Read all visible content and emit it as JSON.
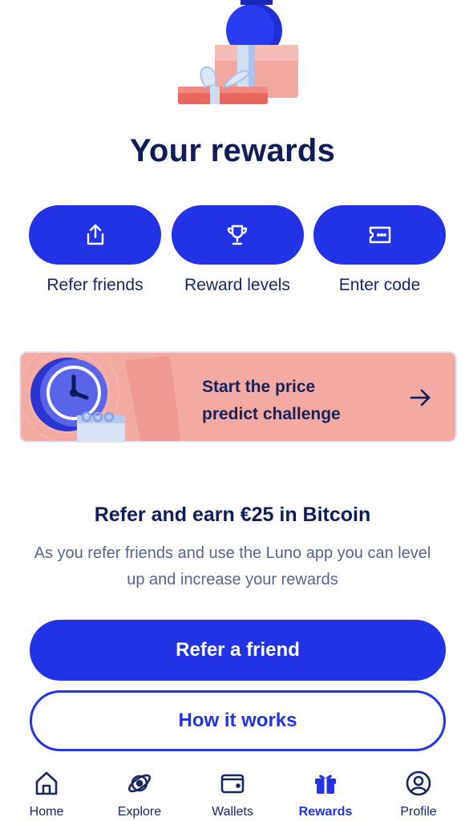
{
  "page": {
    "title": "Your rewards"
  },
  "actions": [
    {
      "label": "Refer friends",
      "icon": "share-icon"
    },
    {
      "label": "Reward levels",
      "icon": "trophy-icon"
    },
    {
      "label": "Enter code",
      "icon": "ticket-icon"
    }
  ],
  "promo": {
    "line1": "Start the price",
    "line2": "predict challenge",
    "icon": "arrow-right-icon"
  },
  "refer": {
    "title": "Refer and earn €25 in Bitcoin",
    "description": "As you refer friends and use the Luno app you can level up and increase your rewards"
  },
  "buttons": {
    "primary": "Refer a friend",
    "secondary": "How it works"
  },
  "tabs": [
    {
      "label": "Home",
      "icon": "home-icon",
      "active": false
    },
    {
      "label": "Explore",
      "icon": "explore-icon",
      "active": false
    },
    {
      "label": "Wallets",
      "icon": "wallet-icon",
      "active": false
    },
    {
      "label": "Rewards",
      "icon": "gift-icon",
      "active": true
    },
    {
      "label": "Profile",
      "icon": "profile-icon",
      "active": false
    }
  ],
  "colors": {
    "brand": "#2233e6",
    "heading": "#101c56",
    "promo_bg": "#f2aaa3",
    "muted_text": "#5a6390"
  }
}
